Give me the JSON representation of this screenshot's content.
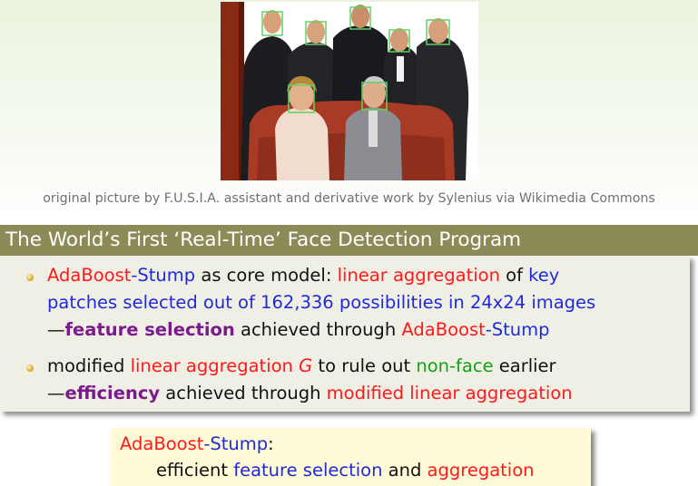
{
  "photo": {
    "icon": "group-portrait-face-detection-photo"
  },
  "credit": "original picture by F.U.S.I.A. assistant and derivative work by Sylenius via Wikimedia Commons",
  "title": "The World’s First ‘Real-Time’ Face Detection Program",
  "bullet1": {
    "line1": {
      "a": "AdaBoost",
      "b": "-Stump",
      "c": " as core model: ",
      "d": "linear aggregation",
      "e": " of ",
      "f": "key"
    },
    "line2": "patches selected out of 162,336 possibilities in 24x24 images",
    "line3": {
      "a": "—",
      "b": "feature selection",
      "c": " achieved through ",
      "d": "AdaBoost",
      "e": "-Stump"
    }
  },
  "bullet2": {
    "line1": {
      "a": "modified ",
      "b": "linear aggregation ",
      "c": "G",
      "d": " to rule out ",
      "e": "non-face",
      "f": " earlier"
    },
    "line2": {
      "a": "—",
      "b": "efficiency",
      "c": " achieved through ",
      "d": "modified linear aggregation"
    }
  },
  "callout": {
    "line1": {
      "a": "AdaBoost",
      "b": "-Stump",
      "c": ":"
    },
    "line2": {
      "a": "efficient ",
      "b": "feature selection",
      "c": " and ",
      "d": "aggregation"
    }
  },
  "colors": {
    "title_bar": "#8c8a57",
    "content_bg": "#f0efe6",
    "callout_bg": "#fffbd8",
    "red": "#ff1a1a",
    "blue": "#1f2bd6",
    "green": "#14a014",
    "purple": "#7a1a8c",
    "face_box": "#5fd35f"
  }
}
